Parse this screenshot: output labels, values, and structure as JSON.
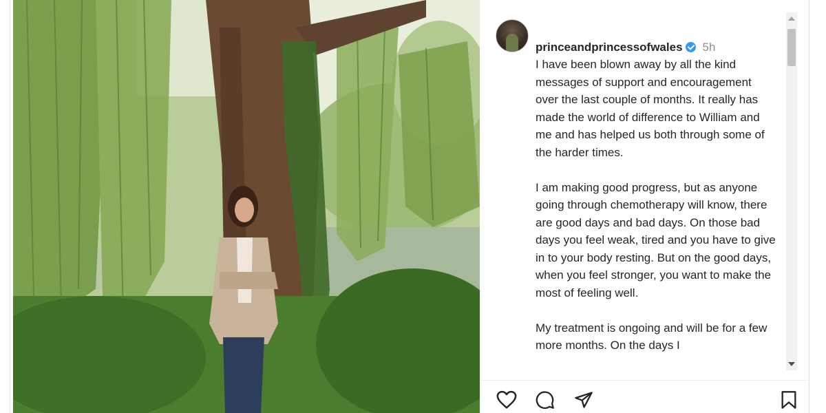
{
  "post": {
    "username": "princeandprincessofwales",
    "verified": true,
    "time": "5h",
    "paragraphs": [
      "I have been blown away by all the kind messages of support and encouragement over the last couple of months. It really has made the world of difference to William and me and has helped us both through some of the harder times.",
      "I am making good progress, but as anyone going through chemotherapy will know, there are good days and bad days. On those bad days you feel weak, tired and you have to give in to your body resting. But on the good days, when you feel stronger, you want to make the most of feeling well.",
      "My treatment is ongoing and will be for a few more months. On the days I"
    ]
  },
  "actions": {
    "like_icon": "heart-icon",
    "comment_icon": "comment-icon",
    "share_icon": "paper-plane-icon",
    "save_icon": "bookmark-icon"
  },
  "colors": {
    "verified_badge": "#3897f0",
    "text": "#262626",
    "muted": "#8e8e8e"
  }
}
